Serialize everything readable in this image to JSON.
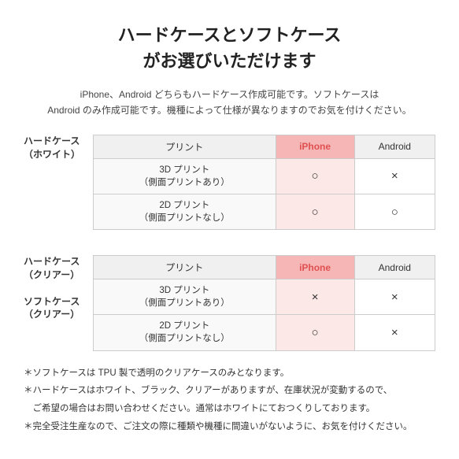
{
  "title": {
    "line1": "ハードケースとソフトケース",
    "line2": "がお選びいただけます"
  },
  "subtitle": "iPhone、Android どちらもハードケース作成可能です。ソフトケースは\nAndroid のみ作成可能です。機種によって仕様が異なりますのでお気を付けください。",
  "table1": {
    "row_header": "ハードケース\n（ホワイト）",
    "col_print": "プリント",
    "col_iphone": "iPhone",
    "col_android": "Android",
    "rows": [
      {
        "print": "3D プリント\n（側面プリントあり）",
        "iphone": "○",
        "android": "×"
      },
      {
        "print": "2D プリント\n（側面プリントなし）",
        "iphone": "○",
        "android": "○"
      }
    ]
  },
  "table2": {
    "row_header1": "ハードケース\n（クリアー）",
    "row_header2": "ソフトケース\n（クリアー）",
    "col_print": "プリント",
    "col_iphone": "iPhone",
    "col_android": "Android",
    "rows": [
      {
        "print": "3D プリント\n（側面プリントあり）",
        "iphone": "×",
        "android": "×"
      },
      {
        "print": "2D プリント\n（側面プリントなし）",
        "iphone": "○",
        "android": "×"
      }
    ]
  },
  "notes": [
    "＊ソフトケースは TPU 製で透明のクリアケースのみとなります。",
    "＊ハードケースはホワイト、ブラック、クリアーがありますが、在庫状況が変動するので、",
    "　ご希望の場合はお問い合わせください。通常はホワイトにておつくりしております。",
    "＊完全受注生産なので、ご注文の際に種類や機種に間違いがないように、お気を付けください。"
  ]
}
